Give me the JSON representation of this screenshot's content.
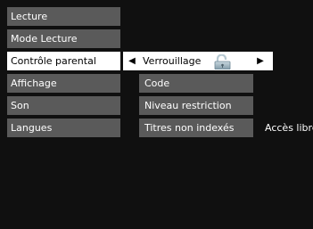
{
  "menu": {
    "items": [
      {
        "label": "Lecture"
      },
      {
        "label": "Mode Lecture"
      },
      {
        "label": "Contrôle parental"
      },
      {
        "label": "Affichage"
      },
      {
        "label": "Son"
      },
      {
        "label": "Langues"
      }
    ],
    "selected_index": 2
  },
  "submenu": {
    "lock": {
      "label": "Verrouillage",
      "state_icon": "unlocked-padlock-icon",
      "left_arrow": "◀",
      "right_arrow": "▶"
    },
    "items": [
      {
        "label": "Code"
      },
      {
        "label": "Niveau restriction"
      },
      {
        "label": "Titres non indexés"
      }
    ],
    "unrated_titles_value": "Accès libre"
  },
  "colors": {
    "background": "#101010",
    "item_bg": "#5a5a5a",
    "selected_bg": "#ffffff"
  }
}
